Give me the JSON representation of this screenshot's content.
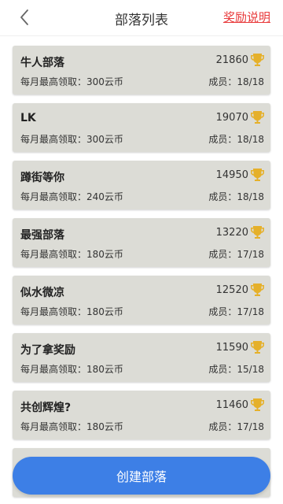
{
  "header": {
    "title": "部落列表",
    "reward_link": "奖励说明"
  },
  "tribes": [
    {
      "name": "牛人部落",
      "score": "21860",
      "quota": "每月最高领取：300云币",
      "members": "成员：18/18"
    },
    {
      "name": "LK",
      "score": "19070",
      "quota": "每月最高领取：300云币",
      "members": "成员：18/18"
    },
    {
      "name": "蹲街等你",
      "score": "14950",
      "quota": "每月最高领取：240云币",
      "members": "成员：18/18"
    },
    {
      "name": "最强部落",
      "score": "13220",
      "quota": "每月最高领取：180云币",
      "members": "成员：17/18"
    },
    {
      "name": "似水微凉",
      "score": "12520",
      "quota": "每月最高领取：180云币",
      "members": "成员：17/18"
    },
    {
      "name": "为了拿奖励",
      "score": "11590",
      "quota": "每月最高领取：180云币",
      "members": "成员：15/18"
    },
    {
      "name": "共创辉煌?",
      "score": "11460",
      "quota": "每月最高领取：180云币",
      "members": "成员：17/18"
    }
  ],
  "create_button": {
    "label": "创建部落"
  },
  "icons": {
    "back": "chevron-left-icon",
    "trophy": "trophy-icon"
  },
  "colors": {
    "accent": "#3d7fe6",
    "link": "#e8393a",
    "card": "#dcdcd6",
    "trophy": "#e5b02a"
  }
}
